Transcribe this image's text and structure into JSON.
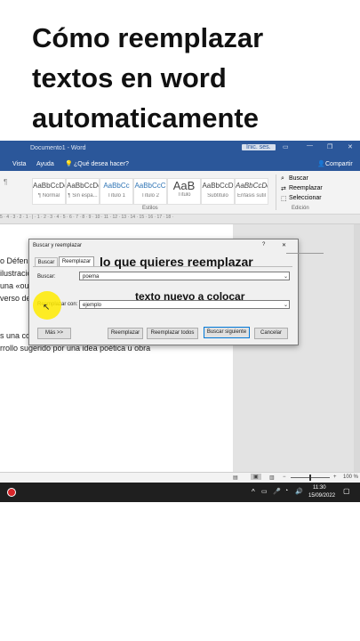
{
  "headline": {
    "line1": "Cómo reemplazar",
    "line2": "textos en word",
    "line3": "automaticamente"
  },
  "word": {
    "title": "Documento1 - Word",
    "signin": "Inic. ses.",
    "tabs": {
      "vista": "Vista",
      "ayuda": "Ayuda",
      "tell_me": "¿Qué desea hacer?",
      "share": "Compartir"
    },
    "styles": [
      {
        "preview": "AaBbCcDc",
        "name": "¶ Normal"
      },
      {
        "preview": "AaBbCcDc",
        "name": "¶ Sin espa..."
      },
      {
        "preview": "AaBbCc",
        "name": "Título 1"
      },
      {
        "preview": "AaBbCcC",
        "name": "Título 2"
      },
      {
        "preview": "AaB",
        "name": "Título"
      },
      {
        "preview": "AaBbCcD",
        "name": "Subtítulo"
      },
      {
        "preview": "AaBbCcDc",
        "name": "Énfasis sutil"
      }
    ],
    "styles_group": "Estilos",
    "editing": {
      "buscar": "Buscar",
      "reemplazar": "Reemplazar",
      "seleccionar": "Seleccionar",
      "group": "Edición"
    },
    "ruler": "5 · 4 · 3 · 2 · 1 · | · 1 · 2 · 3 · 4 · 5 · 6 · 7 · 8 · 9 · 10 · 11 · 12 · 13 · 14 · 15 · 16 · 17 · 18 ·",
    "doc_lines": [
      "o Défens",
      "ilustració",
      "una «ou",
      "verso de",
      "s una co",
      "rrollo sugerido por una idea poética u obra"
    ],
    "zoom": "100 %",
    "clock_time": "11:30",
    "clock_date": "15/09/2022"
  },
  "dialog": {
    "title": "Buscar y reemplazar",
    "help": "?",
    "close": "✕",
    "tab_buscar": "Buscar",
    "tab_reemplazar": "Reemplazar",
    "label_buscar": "Buscar:",
    "value_buscar": "poema",
    "label_reemplazar": "Reemplazar con:",
    "value_reemplazar": "ejemplo",
    "btn_mas": "Más >>",
    "btn_reemplazar": "Reemplazar",
    "btn_reemplazar_todos": "Reemplazar todos",
    "btn_buscar_siguiente": "Buscar siguiente",
    "btn_cancelar": "Cancelar"
  },
  "overlay": {
    "find_hint": "lo que quieres reemplazar",
    "replace_hint": "texto nuevo a colocar"
  }
}
